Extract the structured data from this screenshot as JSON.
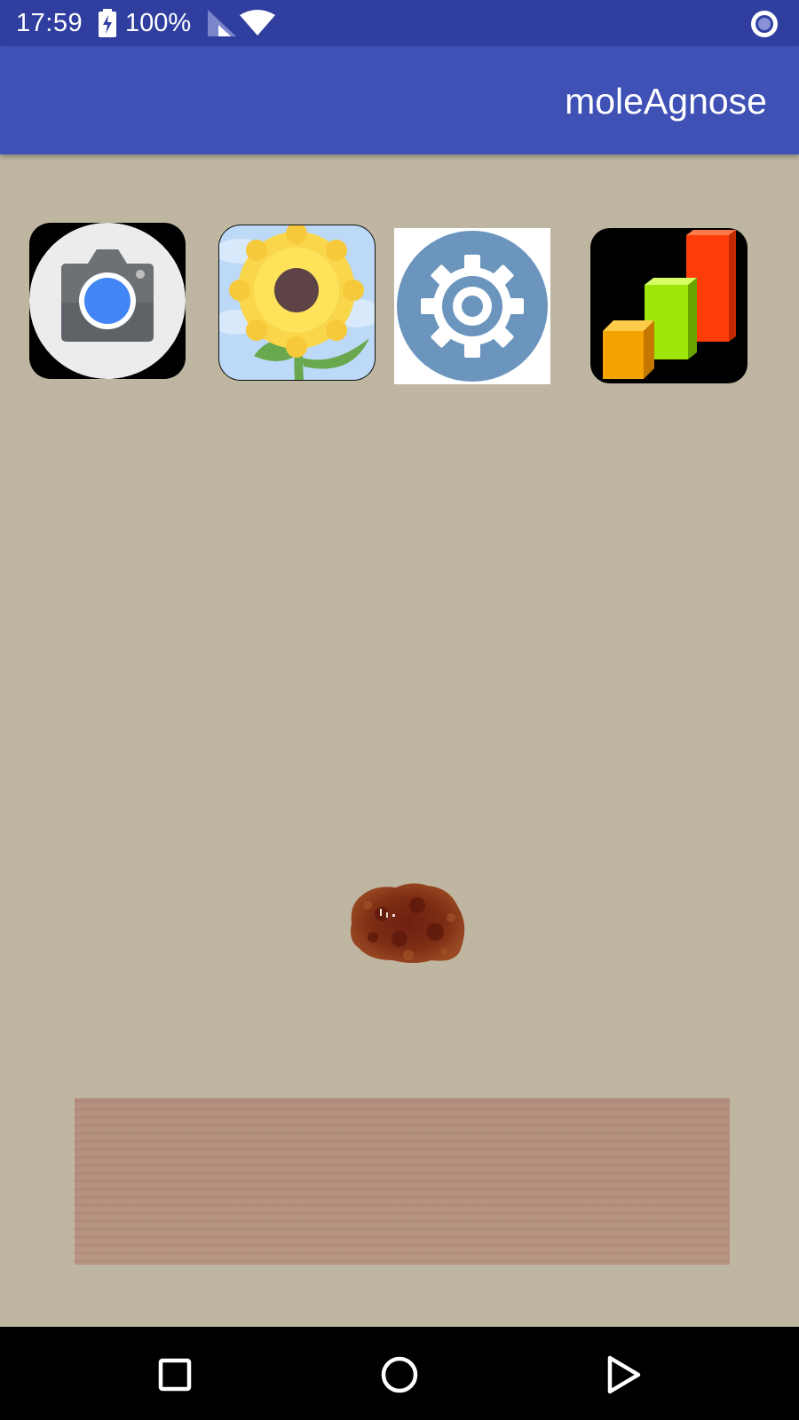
{
  "status_bar": {
    "time": "17:59",
    "battery": "100%",
    "icons": [
      "battery-charging-icon",
      "cellular-signal-icon",
      "wifi-icon",
      "screen-record-icon"
    ],
    "background_color": "#303f9f"
  },
  "app_bar": {
    "title": "moleAgnose",
    "background_color": "#3f51b5"
  },
  "toolbar": {
    "buttons": [
      {
        "name": "camera",
        "icon": "camera-icon"
      },
      {
        "name": "gallery",
        "icon": "sunflower-gallery-icon"
      },
      {
        "name": "settings",
        "icon": "gear-icon"
      },
      {
        "name": "statistics",
        "icon": "bar-chart-3d-icon"
      }
    ]
  },
  "main": {
    "background_color": "#bfb6a1",
    "mole_image": "mole-image",
    "result_text": ""
  },
  "nav_bar": {
    "buttons": [
      "recents-icon",
      "home-icon",
      "back-icon"
    ]
  }
}
